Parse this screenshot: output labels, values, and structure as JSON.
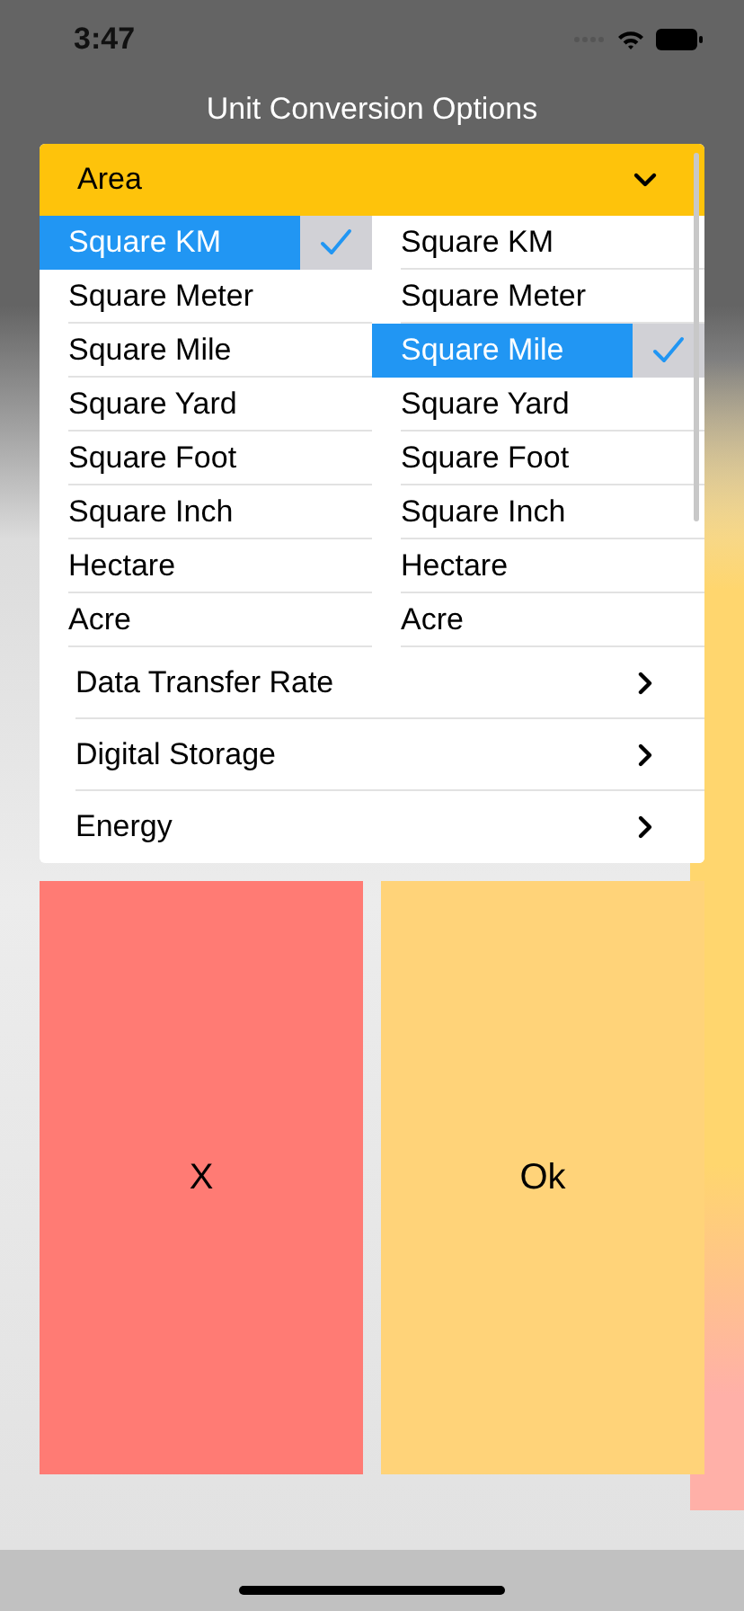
{
  "status_bar": {
    "time": "3:47"
  },
  "title": "Unit Conversion Options",
  "picker": {
    "header": {
      "label": "Area",
      "expanded": true
    },
    "from_units": [
      {
        "label": "Square KM",
        "selected": true
      },
      {
        "label": "Square Meter",
        "selected": false
      },
      {
        "label": "Square Mile",
        "selected": false
      },
      {
        "label": "Square Yard",
        "selected": false
      },
      {
        "label": "Square Foot",
        "selected": false
      },
      {
        "label": "Square Inch",
        "selected": false
      },
      {
        "label": "Hectare",
        "selected": false
      },
      {
        "label": "Acre",
        "selected": false
      }
    ],
    "to_units": [
      {
        "label": "Square KM",
        "selected": false
      },
      {
        "label": "Square Meter",
        "selected": false
      },
      {
        "label": "Square Mile",
        "selected": true
      },
      {
        "label": "Square Yard",
        "selected": false
      },
      {
        "label": "Square Foot",
        "selected": false
      },
      {
        "label": "Square Inch",
        "selected": false
      },
      {
        "label": "Hectare",
        "selected": false
      },
      {
        "label": "Acre",
        "selected": false
      }
    ],
    "categories": [
      {
        "label": "Data Transfer Rate",
        "expanded": false
      },
      {
        "label": "Digital Storage",
        "expanded": false
      },
      {
        "label": "Energy",
        "expanded": false
      }
    ]
  },
  "buttons": [
    {
      "label": "X",
      "kind": "cancel"
    },
    {
      "label": "Ok",
      "kind": "confirm"
    }
  ]
}
